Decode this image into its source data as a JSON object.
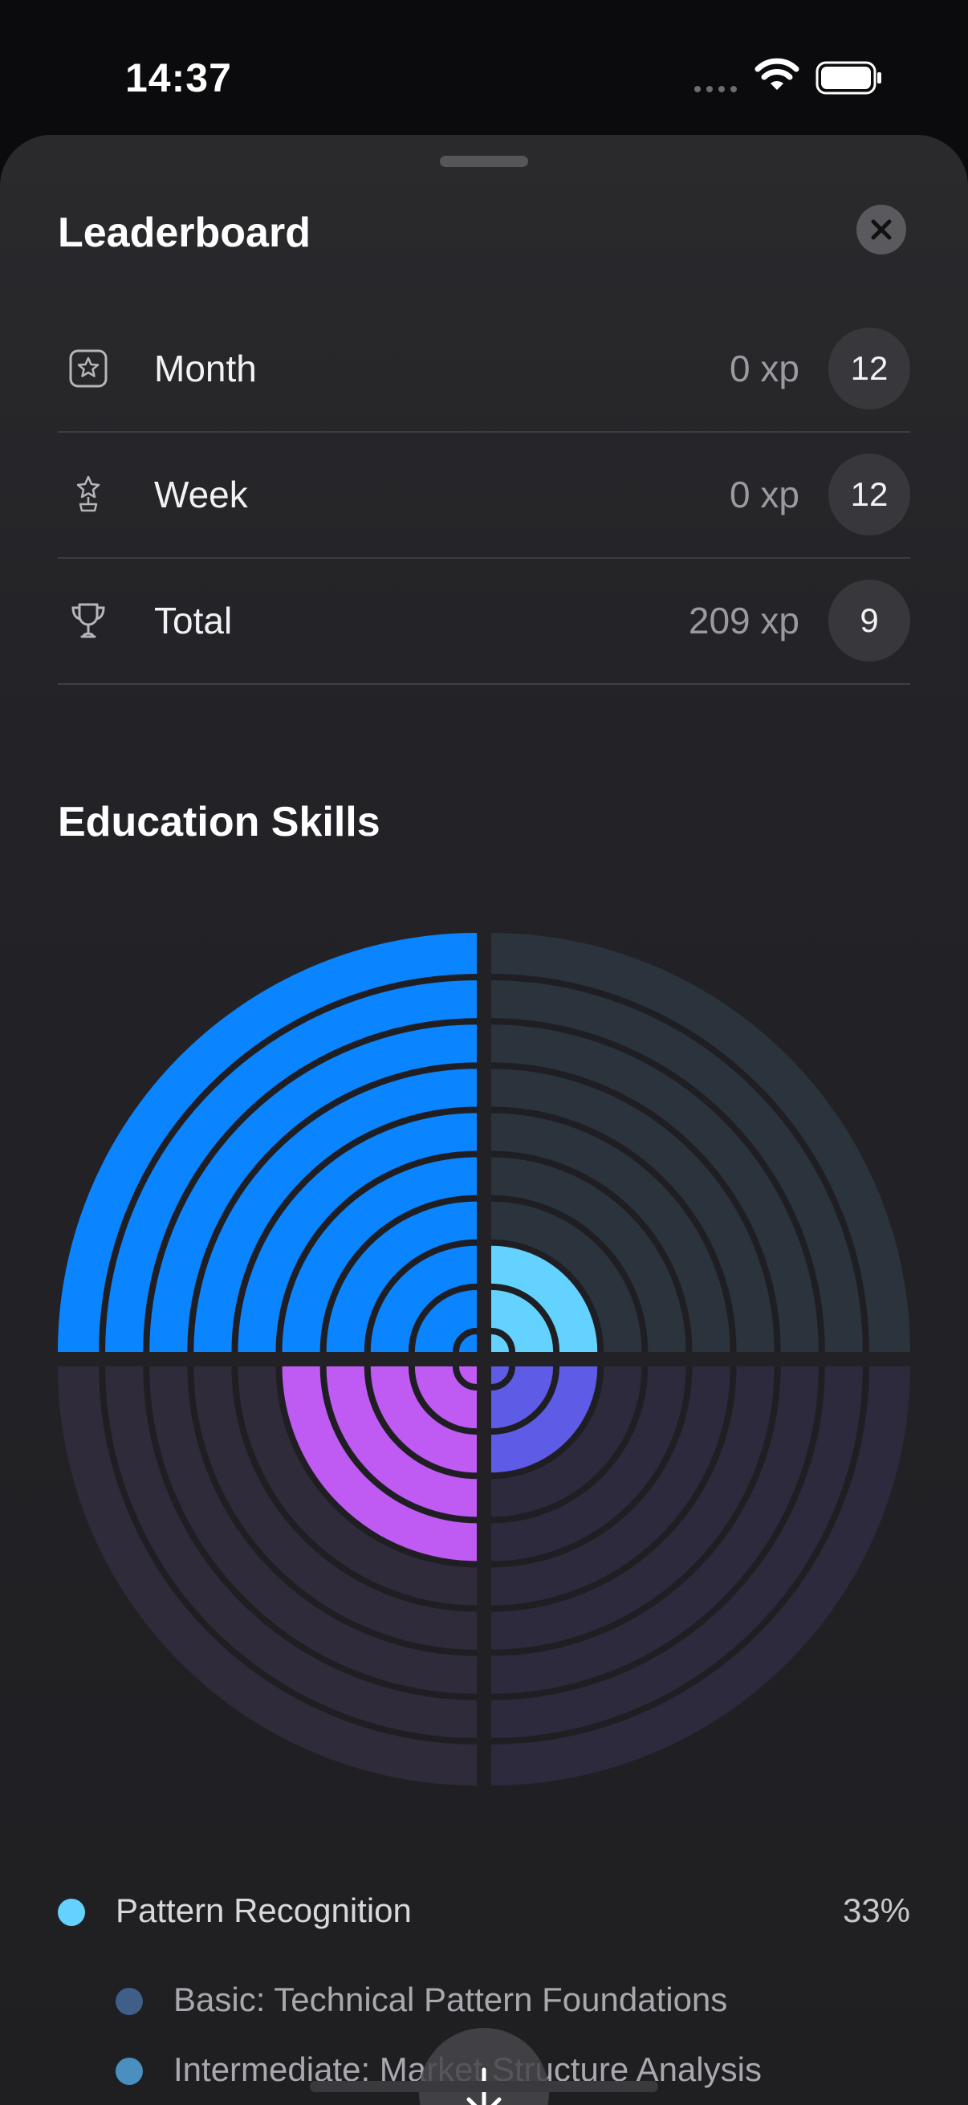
{
  "status_bar": {
    "time": "14:37"
  },
  "sheet": {
    "title": "Leaderboard"
  },
  "leaderboard": [
    {
      "label": "Month",
      "xp": "0 xp",
      "rank": "12",
      "icon": "star-badge-icon"
    },
    {
      "label": "Week",
      "xp": "0 xp",
      "rank": "12",
      "icon": "award-icon"
    },
    {
      "label": "Total",
      "xp": "209 xp",
      "rank": "9",
      "icon": "trophy-icon"
    }
  ],
  "skills": {
    "title": "Education Skills",
    "legend": [
      {
        "label": "Pattern Recognition",
        "value": "33%",
        "color": "#64d2ff"
      }
    ],
    "sub_items": [
      {
        "label": "Basic: Technical Pattern Foundations",
        "color": "#3f5f88"
      },
      {
        "label": "Intermediate: Market Structure Analysis",
        "color": "#4a8fc0"
      }
    ]
  },
  "chart_data": {
    "type": "polar-area",
    "rings": 10,
    "quadrants": [
      {
        "position": "top-left",
        "filled_rings": 10,
        "color": "#0a84ff"
      },
      {
        "position": "top-right",
        "filled_rings": 3,
        "color": "#64d2ff"
      },
      {
        "position": "bottom-left",
        "filled_rings": 5,
        "color": "#bf5af2"
      },
      {
        "position": "bottom-right",
        "filled_rings": 3,
        "color": "#5e5ce6"
      }
    ],
    "empty_colors": {
      "top-left": "#2b333c",
      "top-right": "#2b333c",
      "bottom-left": "#2f2b3a",
      "bottom-right": "#2c2a3c"
    }
  },
  "icons": {
    "close": "close-icon",
    "scroll": "arrow-down-icon"
  }
}
